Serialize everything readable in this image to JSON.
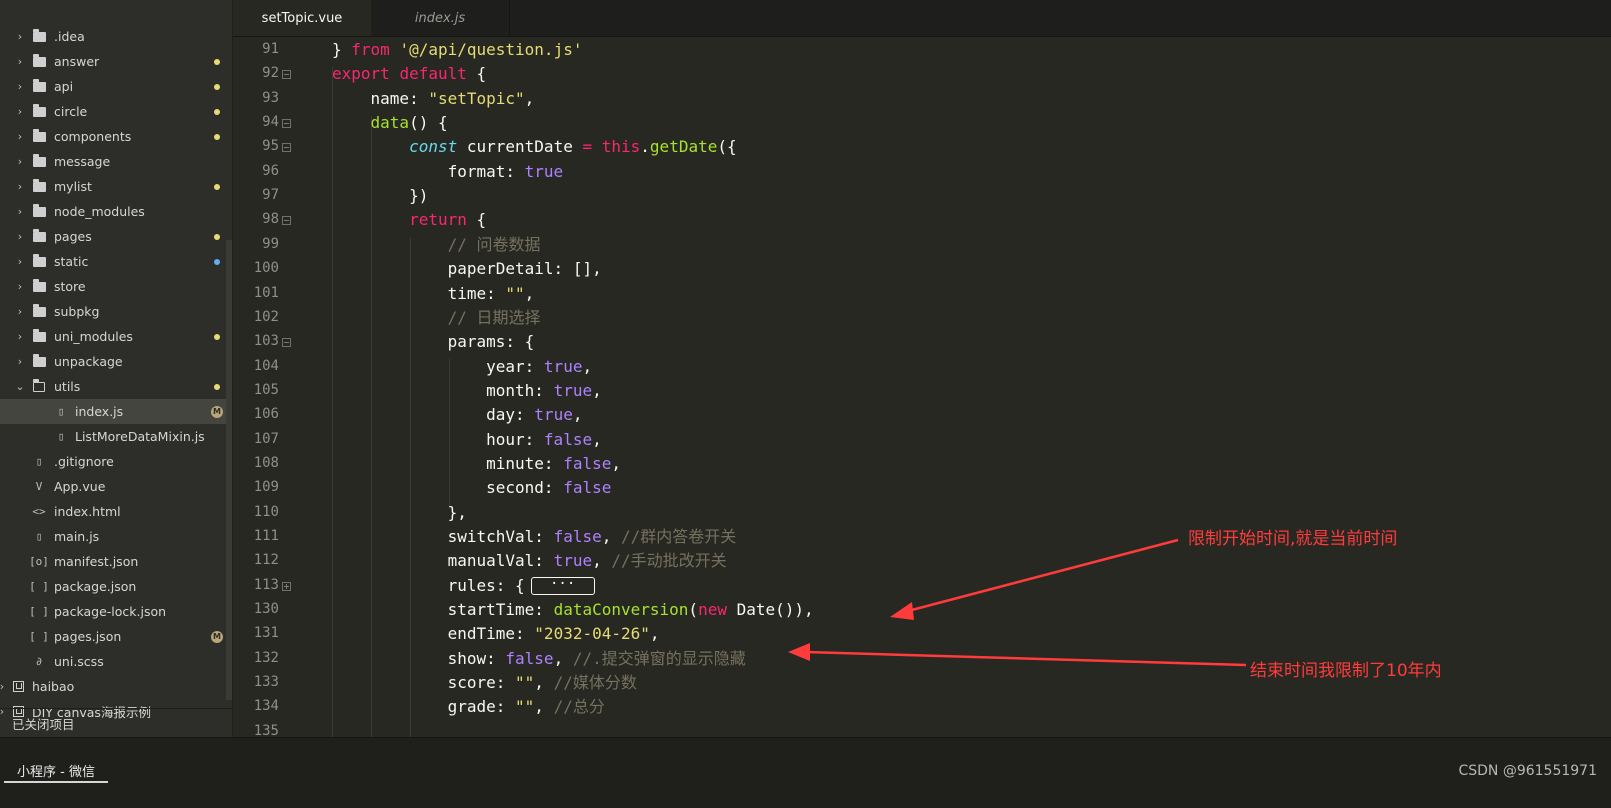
{
  "sidebar": {
    "items": [
      {
        "label": ".idea",
        "type": "folder",
        "indent": 0,
        "status": ""
      },
      {
        "label": "answer",
        "type": "folder",
        "indent": 0,
        "status": "modified"
      },
      {
        "label": "api",
        "type": "folder",
        "indent": 0,
        "status": "modified"
      },
      {
        "label": "circle",
        "type": "folder",
        "indent": 0,
        "status": "modified"
      },
      {
        "label": "components",
        "type": "folder",
        "indent": 0,
        "status": "modified"
      },
      {
        "label": "message",
        "type": "folder",
        "indent": 0,
        "status": ""
      },
      {
        "label": "mylist",
        "type": "folder",
        "indent": 0,
        "status": "modified"
      },
      {
        "label": "node_modules",
        "type": "folder",
        "indent": 0,
        "status": ""
      },
      {
        "label": "pages",
        "type": "folder",
        "indent": 0,
        "status": "modified"
      },
      {
        "label": "static",
        "type": "folder",
        "indent": 0,
        "status": "added"
      },
      {
        "label": "store",
        "type": "folder",
        "indent": 0,
        "status": ""
      },
      {
        "label": "subpkg",
        "type": "folder",
        "indent": 0,
        "status": ""
      },
      {
        "label": "uni_modules",
        "type": "folder",
        "indent": 0,
        "status": "modified"
      },
      {
        "label": "unpackage",
        "type": "folder",
        "indent": 0,
        "status": ""
      },
      {
        "label": "utils",
        "type": "folder-open",
        "indent": 0,
        "status": "modified"
      },
      {
        "label": "index.js",
        "type": "file-js",
        "indent": 1,
        "status": "M",
        "selected": true
      },
      {
        "label": "ListMoreDataMixin.js",
        "type": "file-js",
        "indent": 1,
        "status": ""
      },
      {
        "label": ".gitignore",
        "type": "file",
        "indent": 0,
        "status": ""
      },
      {
        "label": "App.vue",
        "type": "file-vue",
        "indent": 0,
        "status": ""
      },
      {
        "label": "index.html",
        "type": "file-html",
        "indent": 0,
        "status": ""
      },
      {
        "label": "main.js",
        "type": "file-js",
        "indent": 0,
        "status": ""
      },
      {
        "label": "manifest.json",
        "type": "file-manifest",
        "indent": 0,
        "status": ""
      },
      {
        "label": "package.json",
        "type": "file-json",
        "indent": 0,
        "status": ""
      },
      {
        "label": "package-lock.json",
        "type": "file-json",
        "indent": 0,
        "status": ""
      },
      {
        "label": "pages.json",
        "type": "file-json",
        "indent": 0,
        "status": "M"
      },
      {
        "label": "uni.scss",
        "type": "file-scss",
        "indent": 0,
        "status": ""
      },
      {
        "label": "haibao",
        "type": "project",
        "indent": -1,
        "status": ""
      },
      {
        "label": "DIY canvas海报示例",
        "type": "project",
        "indent": -1,
        "status": ""
      }
    ],
    "closed_projects_label": "已关闭项目"
  },
  "tabs": [
    {
      "label": "setTopic.vue",
      "active": true
    },
    {
      "label": "index.js",
      "active": false
    }
  ],
  "editor": {
    "lines": [
      {
        "n": "91",
        "fold": "",
        "tokens": [
          [
            "",
            "} "
          ],
          [
            "k",
            "from"
          ],
          [
            "",
            " "
          ],
          [
            "s",
            "'@/api/question.js'"
          ]
        ]
      },
      {
        "n": "92",
        "fold": "-",
        "tokens": [
          [
            "k",
            "export"
          ],
          [
            "",
            " "
          ],
          [
            "k",
            "default"
          ],
          [
            "",
            " {"
          ]
        ]
      },
      {
        "n": "93",
        "fold": "",
        "tokens": [
          [
            "",
            "    name: "
          ],
          [
            "s",
            "\"setTopic\""
          ],
          [
            "",
            ","
          ]
        ]
      },
      {
        "n": "94",
        "fold": "-",
        "tokens": [
          [
            "",
            "    "
          ],
          [
            "f",
            "data"
          ],
          [
            "",
            "() {"
          ]
        ]
      },
      {
        "n": "95",
        "fold": "-",
        "tokens": [
          [
            "",
            "        "
          ],
          [
            "i",
            "const"
          ],
          [
            "",
            " currentDate "
          ],
          [
            "k",
            "="
          ],
          [
            "",
            " "
          ],
          [
            "k",
            "this"
          ],
          [
            "",
            "."
          ],
          [
            "f",
            "getDate"
          ],
          [
            "",
            "({"
          ]
        ]
      },
      {
        "n": "96",
        "fold": "",
        "tokens": [
          [
            "",
            "            format: "
          ],
          [
            "b",
            "true"
          ]
        ]
      },
      {
        "n": "97",
        "fold": "",
        "tokens": [
          [
            "",
            "        })"
          ]
        ]
      },
      {
        "n": "98",
        "fold": "-",
        "tokens": [
          [
            "",
            "        "
          ],
          [
            "k",
            "return"
          ],
          [
            "",
            " {"
          ]
        ]
      },
      {
        "n": "99",
        "fold": "",
        "tokens": [
          [
            "",
            "            "
          ],
          [
            "c",
            "// 问卷数据"
          ]
        ]
      },
      {
        "n": "100",
        "fold": "",
        "tokens": [
          [
            "",
            "            paperDetail: [],"
          ]
        ]
      },
      {
        "n": "101",
        "fold": "",
        "tokens": [
          [
            "",
            "            time: "
          ],
          [
            "s",
            "\"\""
          ],
          [
            "",
            ","
          ]
        ]
      },
      {
        "n": "102",
        "fold": "",
        "tokens": [
          [
            "",
            "            "
          ],
          [
            "c",
            "// 日期选择"
          ]
        ]
      },
      {
        "n": "103",
        "fold": "-",
        "tokens": [
          [
            "",
            "            params: {"
          ]
        ]
      },
      {
        "n": "104",
        "fold": "",
        "tokens": [
          [
            "",
            "                year: "
          ],
          [
            "b",
            "true"
          ],
          [
            "",
            ","
          ]
        ]
      },
      {
        "n": "105",
        "fold": "",
        "tokens": [
          [
            "",
            "                month: "
          ],
          [
            "b",
            "true"
          ],
          [
            "",
            ","
          ]
        ]
      },
      {
        "n": "106",
        "fold": "",
        "tokens": [
          [
            "",
            "                day: "
          ],
          [
            "b",
            "true"
          ],
          [
            "",
            ","
          ]
        ]
      },
      {
        "n": "107",
        "fold": "",
        "tokens": [
          [
            "",
            "                hour: "
          ],
          [
            "b",
            "false"
          ],
          [
            "",
            ","
          ]
        ]
      },
      {
        "n": "108",
        "fold": "",
        "tokens": [
          [
            "",
            "                minute: "
          ],
          [
            "b",
            "false"
          ],
          [
            "",
            ","
          ]
        ]
      },
      {
        "n": "109",
        "fold": "",
        "tokens": [
          [
            "",
            "                second: "
          ],
          [
            "b",
            "false"
          ]
        ]
      },
      {
        "n": "110",
        "fold": "",
        "tokens": [
          [
            "",
            "            },"
          ]
        ]
      },
      {
        "n": "111",
        "fold": "",
        "tokens": [
          [
            "",
            "            switchVal: "
          ],
          [
            "b",
            "false"
          ],
          [
            "",
            ", "
          ],
          [
            "c",
            "//群内答卷开关"
          ]
        ]
      },
      {
        "n": "112",
        "fold": "",
        "tokens": [
          [
            "",
            "            manualVal: "
          ],
          [
            "b",
            "true"
          ],
          [
            "",
            ", "
          ],
          [
            "c",
            "//手动批改开关"
          ]
        ]
      },
      {
        "n": "113",
        "fold": "+",
        "tokens": [
          [
            "",
            "            rules: {"
          ]
        ],
        "collapsed": "···"
      },
      {
        "n": "130",
        "fold": "",
        "tokens": [
          [
            "",
            "            startTime: "
          ],
          [
            "f",
            "dataConversion"
          ],
          [
            "",
            "("
          ],
          [
            "k",
            "new"
          ],
          [
            "",
            " Date()),"
          ]
        ]
      },
      {
        "n": "131",
        "fold": "",
        "tokens": [
          [
            "",
            "            endTime: "
          ],
          [
            "s",
            "\"2032-04-26\""
          ],
          [
            "",
            ","
          ]
        ]
      },
      {
        "n": "132",
        "fold": "",
        "tokens": [
          [
            "",
            "            show: "
          ],
          [
            "b",
            "false"
          ],
          [
            "",
            ", "
          ],
          [
            "c",
            "//.提交弹窗的显示隐藏"
          ]
        ]
      },
      {
        "n": "133",
        "fold": "",
        "tokens": [
          [
            "",
            "            score: "
          ],
          [
            "s",
            "\"\""
          ],
          [
            "",
            ", "
          ],
          [
            "c",
            "//媒体分数"
          ]
        ]
      },
      {
        "n": "134",
        "fold": "",
        "tokens": [
          [
            "",
            "            grade: "
          ],
          [
            "s",
            "\"\""
          ],
          [
            "",
            ", "
          ],
          [
            "c",
            "//总分"
          ]
        ]
      },
      {
        "n": "135",
        "fold": "",
        "tokens": []
      }
    ]
  },
  "annotations": [
    {
      "text": "限制开始时间,就是当前时间"
    },
    {
      "text": "结束时间我限制了10年内"
    }
  ],
  "statusbar": {
    "tab_label": "小程序 - 微信",
    "watermark": "CSDN @961551971"
  },
  "colors": {
    "annotation": "#ff3b3b",
    "keyword": "#f92672",
    "string": "#e6db74",
    "function": "#a6e22e",
    "comment": "#75715e",
    "boolean": "#ae81ff"
  }
}
